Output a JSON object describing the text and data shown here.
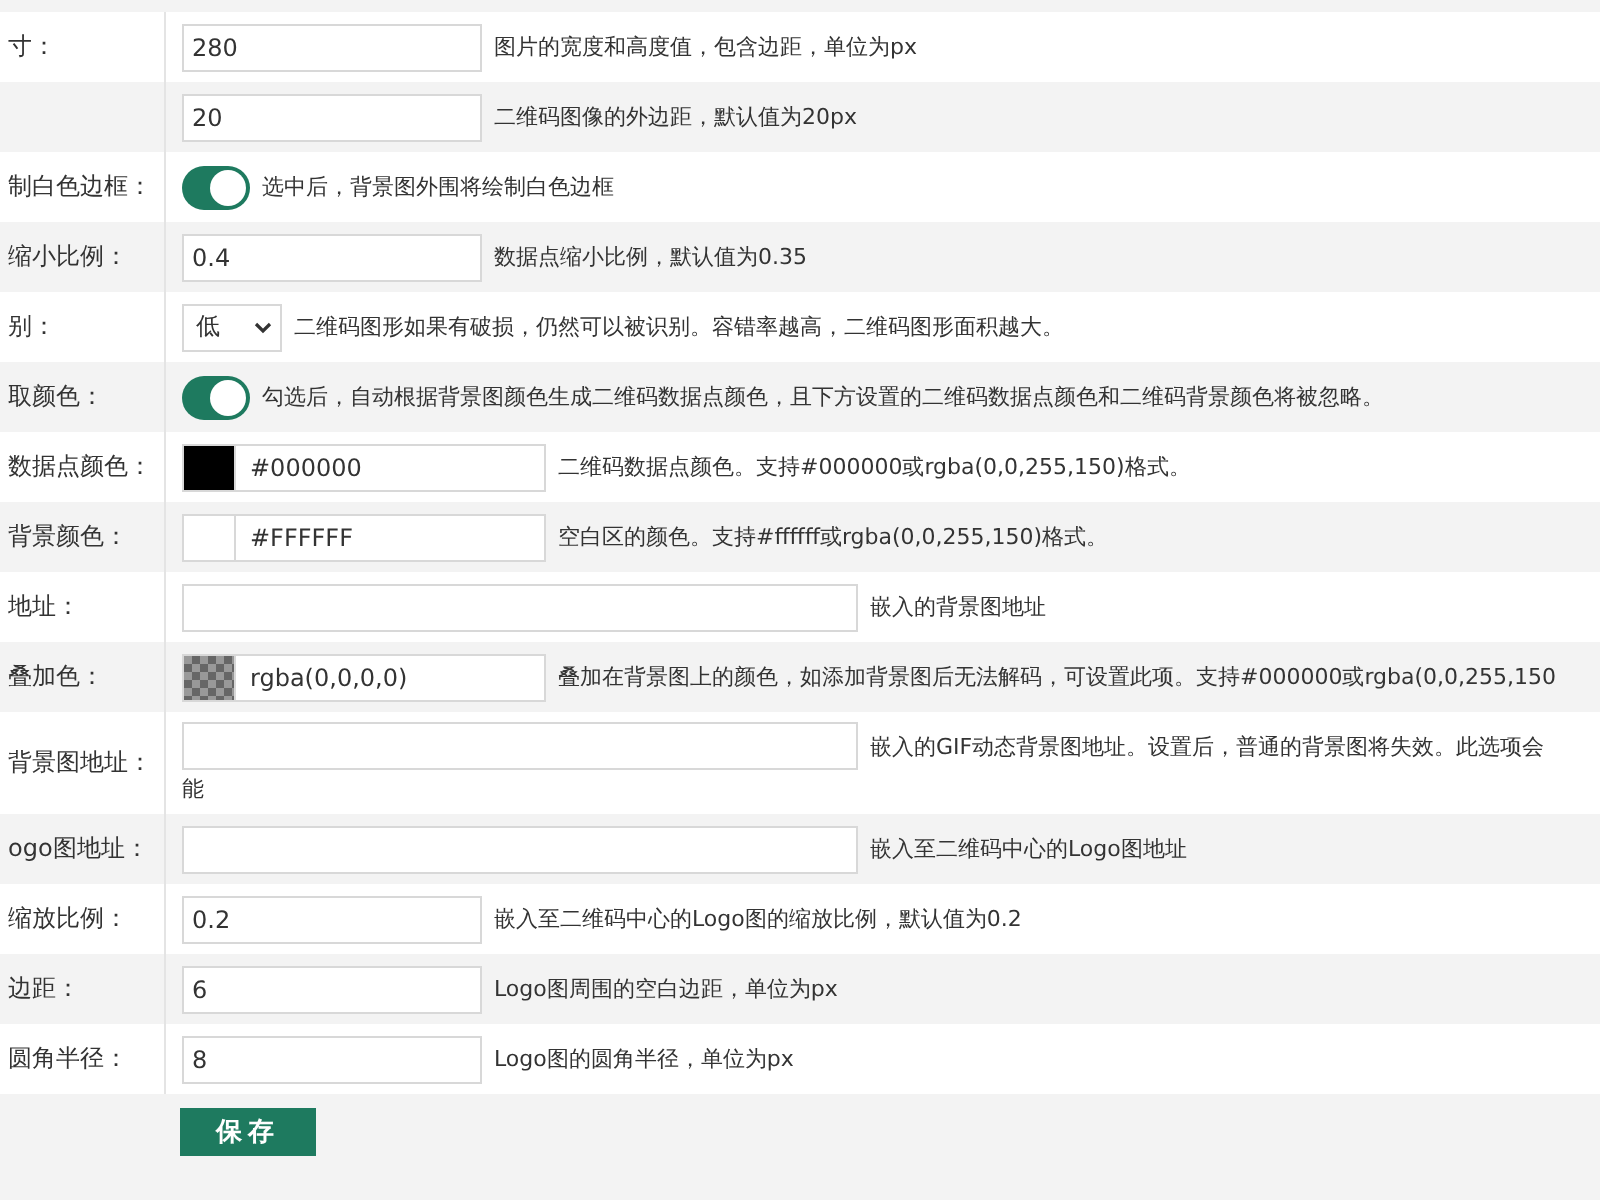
{
  "rows": [
    {
      "label": "寸：",
      "field": {
        "kind": "text",
        "value": "280"
      },
      "description": "图片的宽度和高度值，包含边距，单位为px"
    },
    {
      "field": {
        "kind": "text",
        "value": "20"
      },
      "description": "二维码图像的外边距，默认值为20px"
    },
    {
      "label": "制白色边框：",
      "field": {
        "kind": "toggle",
        "on": true
      },
      "description": "选中后，背景图外围将绘制白色边框"
    },
    {
      "label": "缩小比例：",
      "field": {
        "kind": "text",
        "value": "0.4"
      },
      "description": "数据点缩小比例，默认值为0.35"
    },
    {
      "label": "别：",
      "field": {
        "kind": "select",
        "value": "低"
      },
      "description": "二维码图形如果有破损，仍然可以被识别。容错率越高，二维码图形面积越大。"
    },
    {
      "label": "取颜色：",
      "field": {
        "kind": "toggle",
        "on": true
      },
      "description": "勾选后，自动根据背景图颜色生成二维码数据点颜色，且下方设置的二维码数据点颜色和二维码背景颜色将被忽略。"
    },
    {
      "label": "数据点颜色：",
      "field": {
        "kind": "color",
        "color": "#000000",
        "value": "#000000"
      },
      "description": "二维码数据点颜色。支持#000000或rgba(0,0,255,150)格式。"
    },
    {
      "label": "背景颜色：",
      "field": {
        "kind": "color",
        "color": "#ffffff",
        "value": "#FFFFFF"
      },
      "description": "空白区的颜色。支持#ffffff或rgba(0,0,255,150)格式。"
    },
    {
      "label": "地址：",
      "field": {
        "kind": "wide"
      },
      "description": "嵌入的背景图地址"
    },
    {
      "label": "叠加色：",
      "field": {
        "kind": "transparent-color",
        "value": "rgba(0,0,0,0)"
      },
      "description": "叠加在背景图上的颜色，如添加背景图后无法解码，可设置此项。支持#000000或rgba(0,0,255,150"
    },
    {
      "label": "背景图地址：",
      "field": {
        "kind": "wide"
      },
      "description": "嵌入的GIF动态背景图地址。设置后，普通的背景图将失效。此选项会",
      "note": "能"
    },
    {
      "label": "ogo图地址：",
      "field": {
        "kind": "wide"
      },
      "description": "嵌入至二维码中心的Logo图地址"
    },
    {
      "label": "缩放比例：",
      "field": {
        "kind": "text",
        "value": "0.2"
      },
      "description": "嵌入至二维码中心的Logo图的缩放比例，默认值为0.2"
    },
    {
      "label": "边距：",
      "field": {
        "kind": "text",
        "value": "6"
      },
      "description": "Logo图周围的空白边距，单位为px"
    },
    {
      "label": "圆角半径：",
      "field": {
        "kind": "text",
        "value": "8"
      },
      "description": "Logo图的圆角半径，单位为px"
    }
  ],
  "save_button": "保存"
}
